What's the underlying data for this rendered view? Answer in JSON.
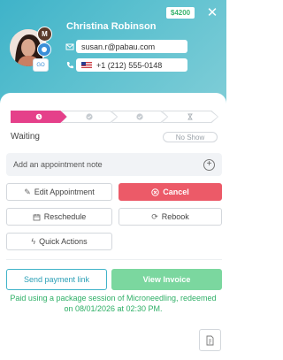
{
  "header": {
    "price_badge": "$4200",
    "close_label": "✕",
    "client_name": "Christina Robinson",
    "avatar_badge": "M",
    "small_badge": "GO",
    "email": "susan.r@pabau.com",
    "phone": "+1 (212) 555-0148"
  },
  "status": {
    "steps": [
      "waiting",
      "confirmed",
      "complete",
      "pending"
    ],
    "active_step": 0,
    "label": "Waiting",
    "no_show_label": "No Show"
  },
  "note": {
    "placeholder": "Add an appointment note",
    "plus": "+"
  },
  "actions": {
    "edit_label": "Edit Appointment",
    "cancel_label": "Cancel",
    "reschedule_label": "Reschedule",
    "rebook_label": "Rebook",
    "quick_label": "Quick Actions"
  },
  "payment": {
    "send_link_label": "Send payment link",
    "view_invoice_label": "View Invoice",
    "paid_message": "Paid using a package session of Microneedling, redeemed on 08/01/2026 at 02:30 PM."
  },
  "colors": {
    "header": "#3fb3c9",
    "active_step": "#e5408a",
    "cancel": "#ec5a68",
    "invoice": "#7bd79f",
    "paid_text": "#2eaf66"
  },
  "icons": [
    "close-icon",
    "mail-icon",
    "phone-icon",
    "clock-icon",
    "check-icon",
    "hourglass-icon",
    "plus-circle-icon",
    "edit-icon",
    "cancel-circle-icon",
    "calendar-icon",
    "rebook-icon",
    "bolt-icon",
    "document-icon"
  ]
}
